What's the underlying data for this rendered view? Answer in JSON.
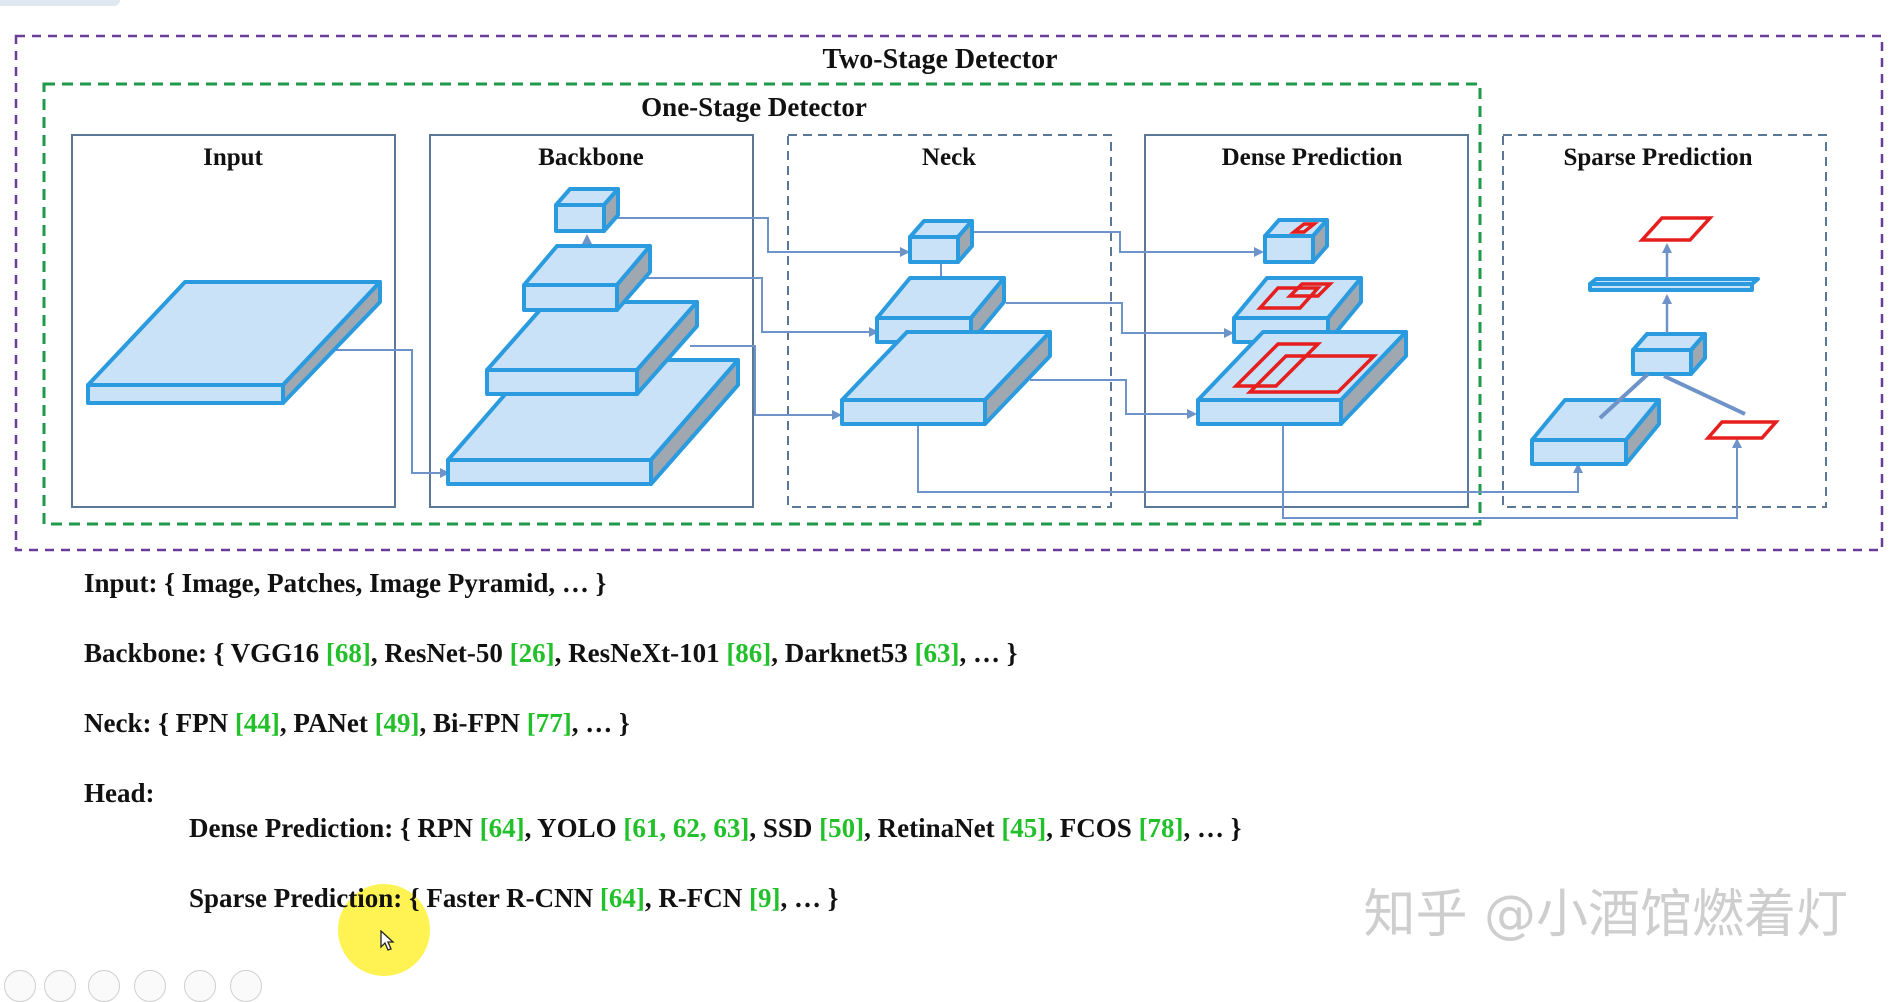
{
  "diagram": {
    "two_stage_label": "Two-Stage Detector",
    "one_stage_label": "One-Stage Detector",
    "panels": {
      "input": "Input",
      "backbone": "Backbone",
      "neck": "Neck",
      "dense": "Dense Prediction",
      "sparse": "Sparse Prediction"
    },
    "colors": {
      "two_stage_border": "#6a3d9a",
      "one_stage_border": "#1e9a4a",
      "block_fill": "#c9e2f7",
      "block_stroke": "#2b9be0",
      "block_side": "#9fa7b0",
      "arrow": "#6d93c9",
      "box_red": "#e61e1e"
    }
  },
  "lines": {
    "input": {
      "prefix": "Input: { Image, Patches, Image Pyramid, … }"
    },
    "backbone": {
      "prefix": "Backbone: { VGG16 ",
      "r1": "[68]",
      "t1": ", ResNet-50 ",
      "r2": "[26]",
      "t2": ", ResNeXt-101 ",
      "r3": "[86]",
      "t3": ", Darknet53 ",
      "r4": "[63]",
      "t4": ", … }"
    },
    "neck": {
      "prefix": "Neck: { FPN ",
      "r1": "[44]",
      "t1": ", PANet ",
      "r2": "[49]",
      "t2": ", Bi-FPN ",
      "r3": "[77]",
      "t3": ", … }"
    },
    "head": {
      "label": "Head:"
    },
    "dense": {
      "prefix": "Dense Prediction: { RPN ",
      "r1": "[64]",
      "t1": ", YOLO ",
      "r2": "[61, 62, 63]",
      "t2": ", SSD ",
      "r3": "[50]",
      "t3": ", RetinaNet ",
      "r4": "[45]",
      "t4": ", FCOS ",
      "r5": "[78]",
      "t5": ", … }"
    },
    "sparse": {
      "prefix": "Sparse Prediction: { Faster R-CNN ",
      "r1": "[64]",
      "t1": ",  R-FCN ",
      "r2": "[9]",
      "t2": ", … }"
    }
  },
  "watermark": "知乎 @小酒馆燃着灯",
  "icons": [
    "toolbar-circle-icon",
    "cursor-arrow-icon"
  ]
}
